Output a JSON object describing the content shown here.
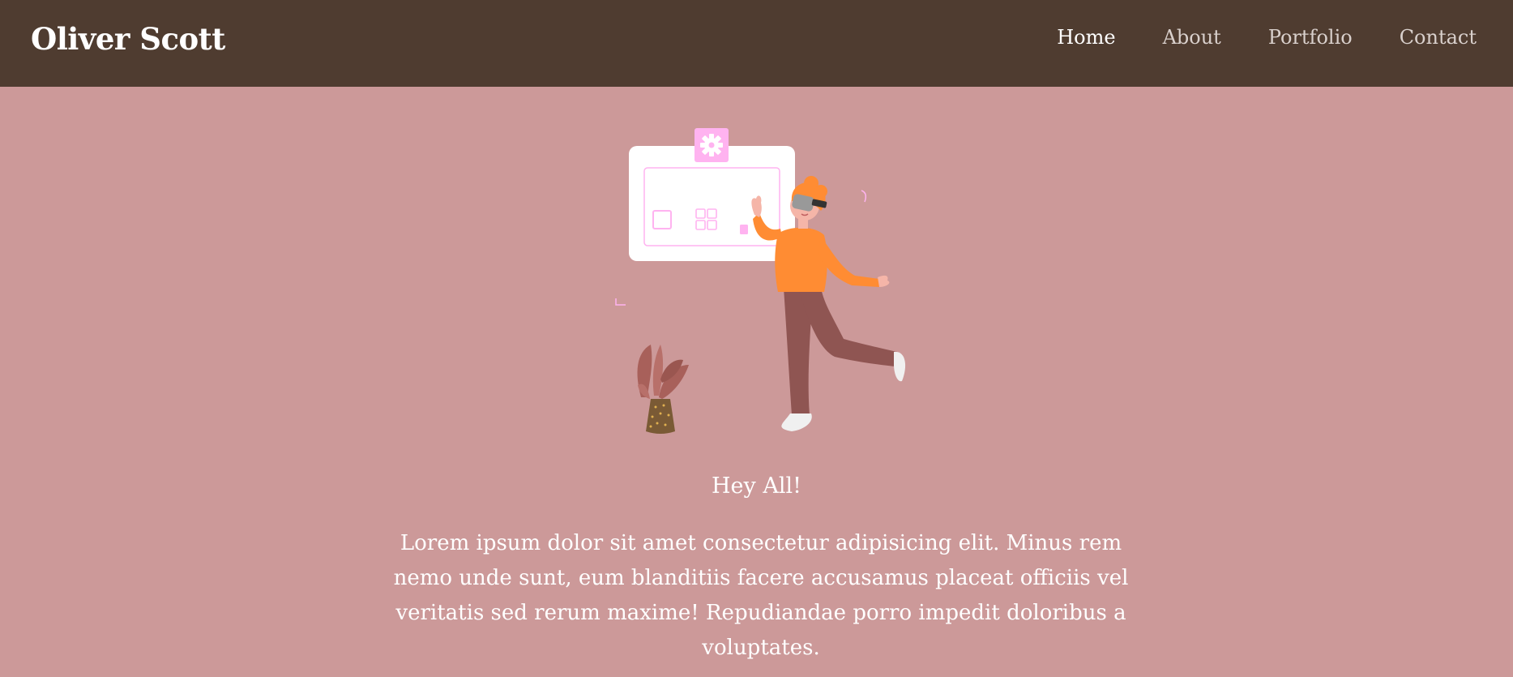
{
  "navbar": {
    "brand": "Oliver Scott",
    "links": [
      {
        "label": "Home",
        "active": true
      },
      {
        "label": "About",
        "active": false
      },
      {
        "label": "Portfolio",
        "active": false
      },
      {
        "label": "Contact",
        "active": false
      }
    ]
  },
  "hero": {
    "illustration": "vr-person-illustration",
    "greeting": "Hey All!",
    "text": "Lorem ipsum dolor sit amet consectetur adipisicing elit. Minus rem nemo unde sunt, eum blanditiis facere accusamus placeat officiis vel veritatis sed rerum maxime! Repudiandae porro impedit doloribus a voluptates."
  },
  "colors": {
    "navbar_bg": "#4f3c30",
    "page_bg": "#cc9999",
    "accent_pink": "#ffb3f0",
    "shirt_orange": "#ff8c33",
    "pants_brown": "#8f5552"
  }
}
